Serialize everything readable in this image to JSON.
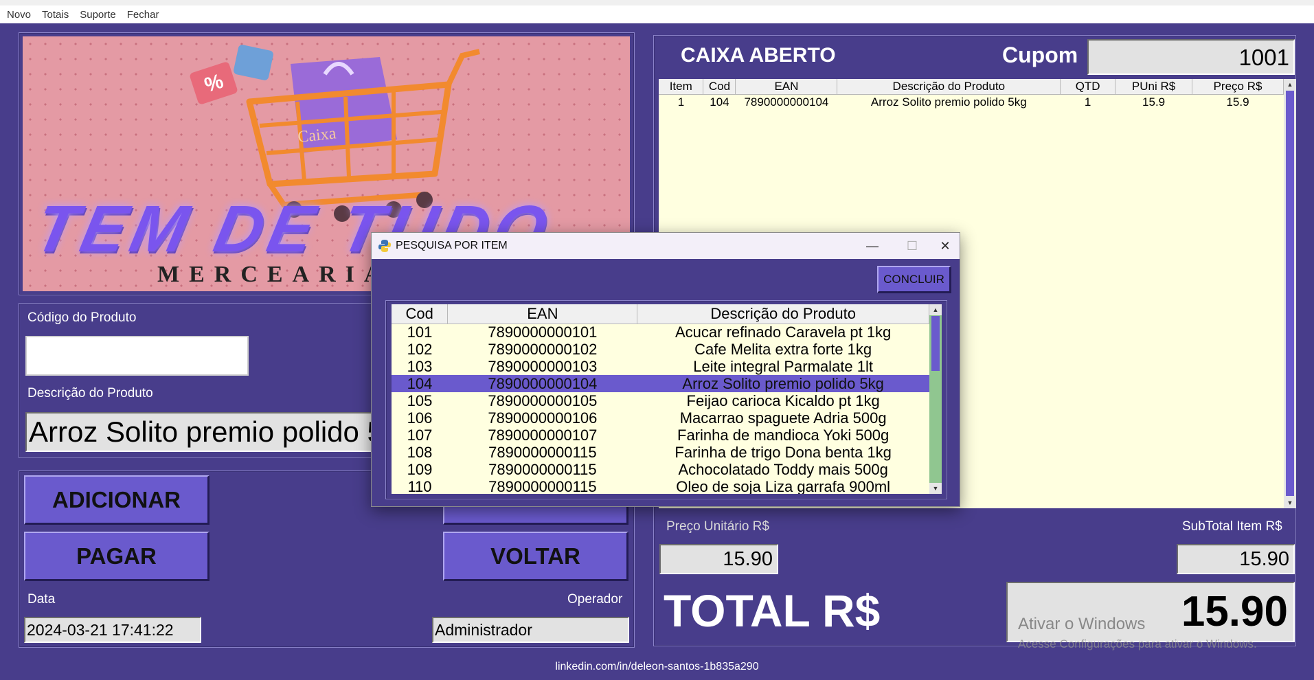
{
  "menu": [
    "Novo",
    "Totais",
    "Suporte",
    "Fechar"
  ],
  "logo": {
    "line1": "TEM DE TUDO",
    "line2": "MERCEARIA",
    "tag": "%",
    "basket_text": "Caixa"
  },
  "form": {
    "codigo_label": "Código do Produto",
    "codigo_value": "",
    "descricao_label": "Descrição do Produto",
    "descricao_value": "Arroz Solito premio polido 5kg",
    "data_label": "Data",
    "data_value": "2024-03-21 17:41:22",
    "operador_label": "Operador",
    "operador_value": "Administrador"
  },
  "buttons": {
    "adicionar": "ADICIONAR",
    "pagar": "PAGAR",
    "voltar": "VOLTAR"
  },
  "header": {
    "status": "CAIXA ABERTO",
    "cupom_label": "Cupom",
    "cupom_value": "1001"
  },
  "cart": {
    "columns": [
      "Item",
      "Cod",
      "EAN",
      "Descrição do Produto",
      "QTD",
      "PUni R$",
      "Preço R$"
    ],
    "rows": [
      [
        "1",
        "104",
        "7890000000104",
        "Arroz Solito premio polido 5kg",
        "1",
        "15.9",
        "15.9"
      ]
    ]
  },
  "totals": {
    "preco_unit_label": "Preço Unitário R$",
    "preco_unit_value": "15.90",
    "subtotal_label": "SubTotal Item R$",
    "subtotal_value": "15.90",
    "total_label": "TOTAL R$",
    "total_value": "15.90"
  },
  "watermark": {
    "line1": "Ativar o Windows",
    "line2": "Acesse Configurações para ativar o Windows."
  },
  "footer": "linkedin.com/in/deleon-santos-1b835a290",
  "popup": {
    "title": "PESQUISA POR ITEM",
    "concluir": "CONCLUIR",
    "minimize": "—",
    "maximize": "☐",
    "close": "✕",
    "columns": [
      "Cod",
      "EAN",
      "Descrição do Produto"
    ],
    "selected_index": 3,
    "rows": [
      [
        "101",
        "7890000000101",
        "Acucar refinado Caravela pt 1kg"
      ],
      [
        "102",
        "7890000000102",
        "Cafe Melita extra forte 1kg"
      ],
      [
        "103",
        "7890000000103",
        "Leite integral Parmalate 1lt"
      ],
      [
        "104",
        "7890000000104",
        "Arroz Solito premio polido 5kg"
      ],
      [
        "105",
        "7890000000105",
        "Feijao carioca Kicaldo pt 1kg"
      ],
      [
        "106",
        "7890000000106",
        "Macarrao spaguete Adria 500g"
      ],
      [
        "107",
        "7890000000107",
        "Farinha de mandioca Yoki 500g"
      ],
      [
        "108",
        "7890000000115",
        "Farinha de trigo Dona benta 1kg"
      ],
      [
        "109",
        "7890000000115",
        "Achocolatado Toddy mais 500g"
      ],
      [
        "110",
        "7890000000115",
        "Oleo de soja Liza garrafa 900ml"
      ]
    ]
  }
}
